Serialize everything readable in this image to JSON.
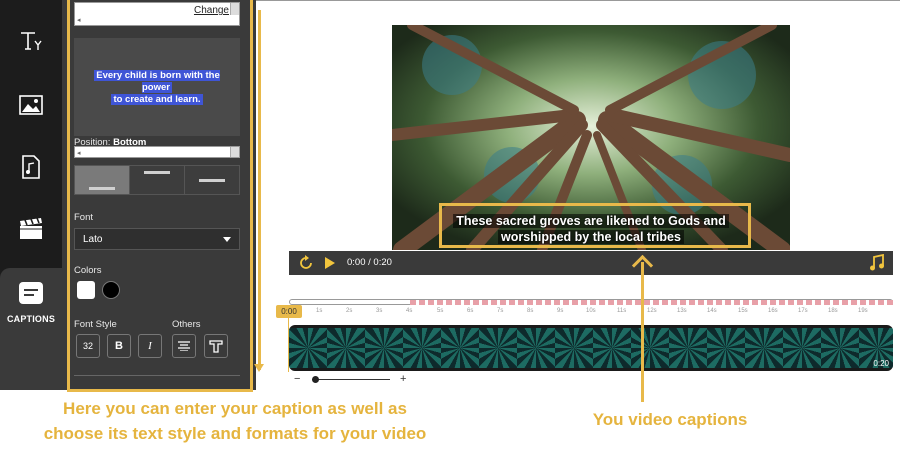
{
  "sidebar": {
    "items": [
      {
        "icon": "text-tool-icon"
      },
      {
        "icon": "image-icon"
      },
      {
        "icon": "music-file-icon"
      },
      {
        "icon": "clapperboard-icon"
      },
      {
        "icon": "captions-icon",
        "label": "CAPTIONS",
        "active": true
      }
    ]
  },
  "caption_panel": {
    "change_link": "Change",
    "preview_text_line1": "Every child is born with the power",
    "preview_text_line2": "to create and learn.",
    "position_label": "Position:",
    "position_value": "Bottom",
    "font_label": "Font",
    "font_value": "Lato",
    "colors_label": "Colors",
    "colors": [
      "#ffffff",
      "#000000"
    ],
    "font_style_label": "Font Style",
    "others_label": "Others",
    "font_size": "32",
    "bold_label": "B",
    "italic_label": "I"
  },
  "player": {
    "caption_line1": "These sacred groves are likened to Gods and",
    "caption_line2": "worshipped by the local tribes",
    "time_current": "0:00",
    "time_separator": "/",
    "time_total": "0:20"
  },
  "timeline": {
    "marker": "0:00",
    "ticks": [
      "0s",
      "1s",
      "2s",
      "3s",
      "4s",
      "5s",
      "6s",
      "7s",
      "8s",
      "9s",
      "10s",
      "11s",
      "12s",
      "13s",
      "14s",
      "15s",
      "16s",
      "17s",
      "18s",
      "19s"
    ],
    "duration": "0:20",
    "zoom_minus": "−",
    "zoom_plus": "+"
  },
  "annotations": {
    "left_line1": "Here you can enter your caption as well as",
    "left_line2": "choose its text style and formats for your video",
    "right": "You video captions"
  },
  "colors": {
    "accent": "#e8b94a",
    "panel": "#3a3a3a",
    "rail": "#1c1c1c",
    "play": "#f2c53d",
    "caption_highlight": "#3f55d6"
  }
}
